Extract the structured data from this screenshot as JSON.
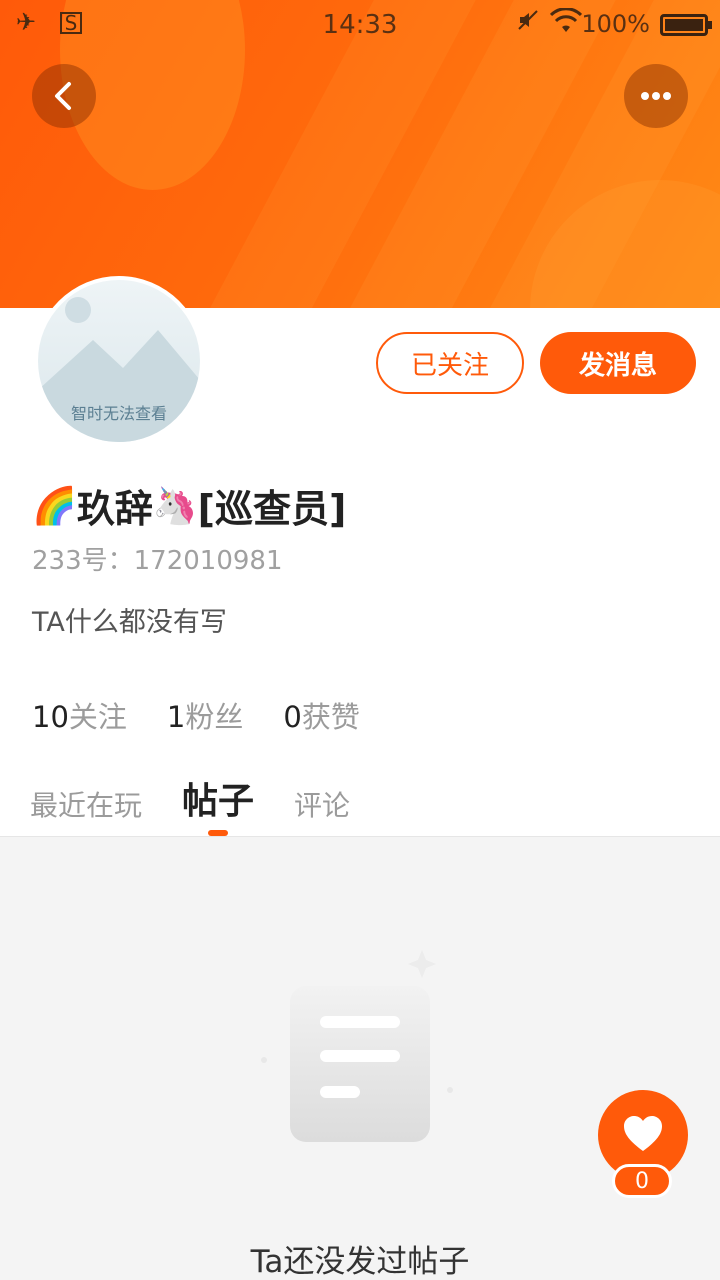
{
  "status_bar": {
    "time": "14:33",
    "battery_text": "100%",
    "icons": [
      "airplane-icon",
      "sim-icon",
      "mute-icon",
      "wifi-icon",
      "battery-icon"
    ]
  },
  "header": {
    "back_icon": "chevron-left-icon",
    "more_icon": "more-dots-icon"
  },
  "profile": {
    "avatar_caption": "智时无法查看",
    "follow_button": "已关注",
    "message_button": "发消息",
    "name_prefix_emoji": "🌈",
    "name": "玖辞",
    "name_suffix_emoji": "🦄",
    "name_tag": "[巡查员]",
    "uid": "233号：172010981",
    "bio": "TA什么都没有写",
    "stats": [
      {
        "num": "10",
        "label": "关注"
      },
      {
        "num": "1",
        "label": "粉丝"
      },
      {
        "num": "0",
        "label": "获赞"
      }
    ]
  },
  "tabs": [
    {
      "label": "最近在玩",
      "active": false
    },
    {
      "label": "帖子",
      "active": true
    },
    {
      "label": "评论",
      "active": false
    }
  ],
  "empty_state": {
    "text": "Ta还没发过帖子"
  },
  "fab": {
    "icon": "heart-icon",
    "count": "0"
  },
  "colors": {
    "accent": "#ff5a0a",
    "banner_start": "#ff5a0a",
    "banner_end": "#ff8a16"
  }
}
